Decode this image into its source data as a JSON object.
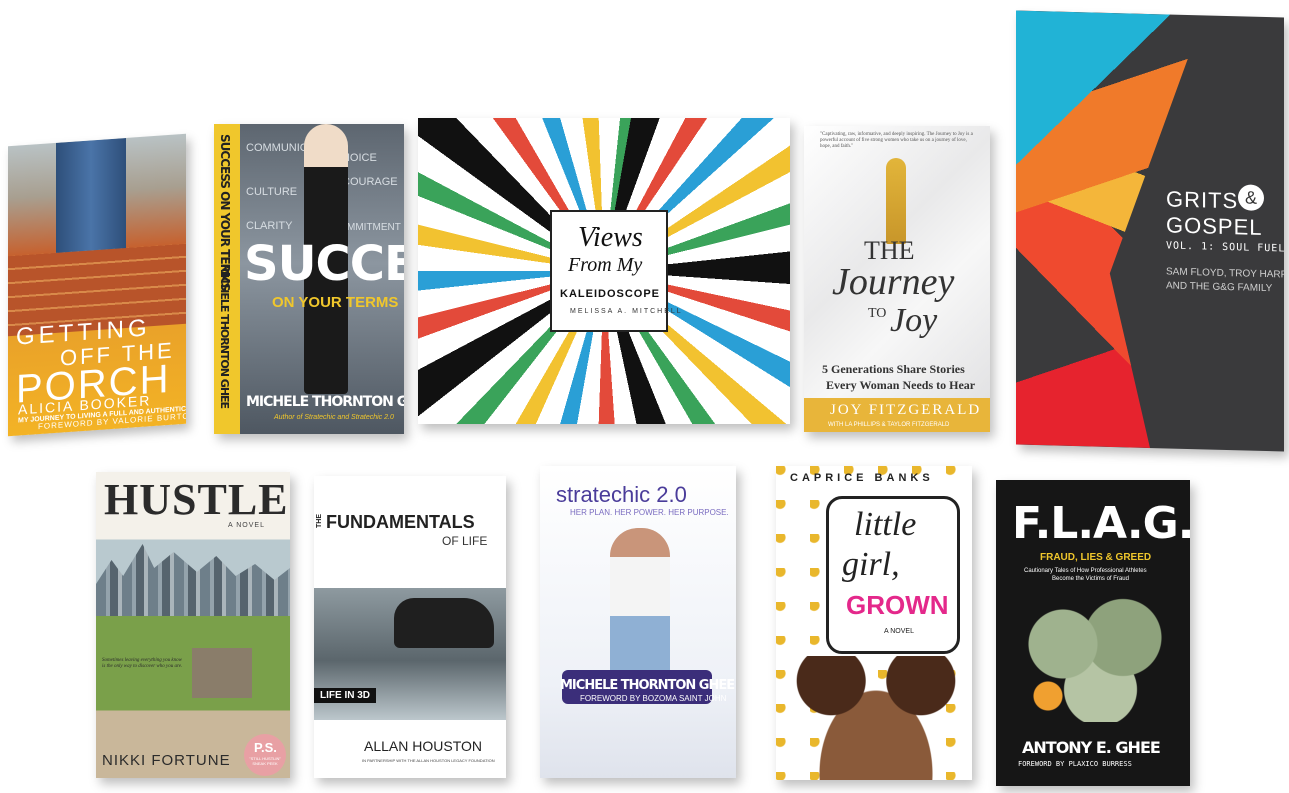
{
  "books": {
    "porch": {
      "title_1": "GETTING",
      "title_2": "OFF THE",
      "title_3": "PORCH",
      "subtitle": "MY JOURNEY TO LIVING A FULL AND AUTHENTIC LIFE",
      "author": "ALICIA BOOKER",
      "foreword": "FOREWORD BY VALORIE BURTON"
    },
    "success": {
      "words": [
        "COMMUNICATE",
        "CHOICE",
        "CULTURE",
        "COURAGE",
        "CLARITY",
        "COMMITMENT"
      ],
      "spine": "SUCCESS ON YOUR TERMS",
      "spine_author": "MICHELE THORNTON GHEE",
      "title": "SUCCESS",
      "subtitle": "ON YOUR TERMS",
      "author": "MICHELE THORNTON GHEE",
      "author_note": "Author of Stratechic and Stratechic 2.0"
    },
    "kaleidoscope": {
      "title_1": "Views",
      "title_2": "From My",
      "title_3": "KALEIDOSCOPE",
      "author": "MELISSA A. MITCHELL"
    },
    "joy": {
      "blurb": "\"Captivating, raw, informative, and deeply inspiring. The Journey to Joy is a powerful account of five strong women who take us on a journey of love, hope, and faith.\"",
      "title_1": "THE",
      "title_2": "Journey",
      "title_3": "TO",
      "title_4": "Joy",
      "subtitle_1": "5 Generations Share Stories",
      "subtitle_2": "Every Woman Needs to Hear",
      "author": "JOY FITZGERALD",
      "with": "WITH LA PHILLIPS & TAYLOR FITZGERALD"
    },
    "grits": {
      "title_1": "GRITS",
      "amp": "&",
      "title_2": "GOSPEL",
      "volume": "VOL. 1: SOUL FUEL",
      "authors_1": "SAM FLOYD, TROY HARRIS",
      "authors_2": "AND THE G&G FAMILY"
    },
    "hustle": {
      "title": "HUSTLE",
      "subtitle": "A NOVEL",
      "blurb": "Sometimes leaving everything you know is the only way to discover who you are.",
      "author": "NIKKI FORTUNE",
      "ps": "P.S.",
      "ps_sub": "\"STILL HUSTLIN\" SNEAK PEEK"
    },
    "fundamentals": {
      "the": "THE",
      "title": "FUNDAMENTALS",
      "of_life": "OF LIFE",
      "badge": "LIFE IN 3D",
      "author": "ALLAN HOUSTON",
      "partnership": "IN PARTNERSHIP WITH THE ALLAN HOUSTON LEGACY FOUNDATION"
    },
    "stratechic": {
      "title": "stratechic 2.0",
      "tagline": "HER PLAN. HER POWER. HER PURPOSE.",
      "author": "MICHELE THORNTON GHEE",
      "foreword": "FOREWORD BY BOZOMA SAINT JOHN"
    },
    "little_girl": {
      "author": "CAPRICE BANKS",
      "title_1": "little",
      "title_2": "girl,",
      "title_3": "GROWN",
      "subtitle": "A NOVEL"
    },
    "flag": {
      "title": "F.L.A.G.",
      "subtitle": "FRAUD, LIES & GREED",
      "tagline_1": "Cautionary Tales of How Professional Athletes",
      "tagline_2": "Become the Victims of Fraud",
      "author": "ANTONY E. GHEE",
      "foreword": "FOREWORD BY PLAXICO BURRESS"
    }
  }
}
